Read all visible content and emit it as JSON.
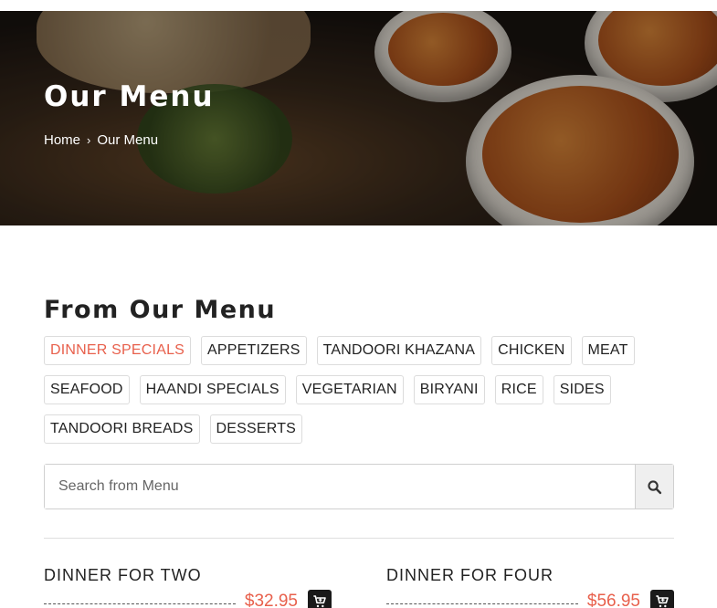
{
  "hero": {
    "title": "Our Menu",
    "breadcrumb": {
      "home": "Home",
      "separator": "›",
      "current": "Our Menu"
    }
  },
  "menu_section": {
    "title": "From Our Menu",
    "categories_row1": [
      "DINNER SPECIALS",
      "APPETIZERS",
      "TANDOORI KHAZANA",
      "CHICKEN",
      "MEAT"
    ],
    "categories_row2": [
      "SEAFOOD",
      "HAANDI SPECIALS",
      "VEGETARIAN",
      "BIRYANI",
      "RICE",
      "SIDES"
    ],
    "categories_row3": [
      "TANDOORI BREADS",
      "DESSERTS"
    ],
    "active_category": "DINNER SPECIALS",
    "accent_color": "#e8604c"
  },
  "search": {
    "placeholder": "Search from Menu",
    "value": "",
    "icon": "search-icon"
  },
  "items": [
    {
      "name": "DINNER FOR TWO",
      "price": "$32.95",
      "icon": "add-to-cart-icon"
    },
    {
      "name": "DINNER FOR FOUR",
      "price": "$56.95",
      "icon": "add-to-cart-icon"
    }
  ]
}
